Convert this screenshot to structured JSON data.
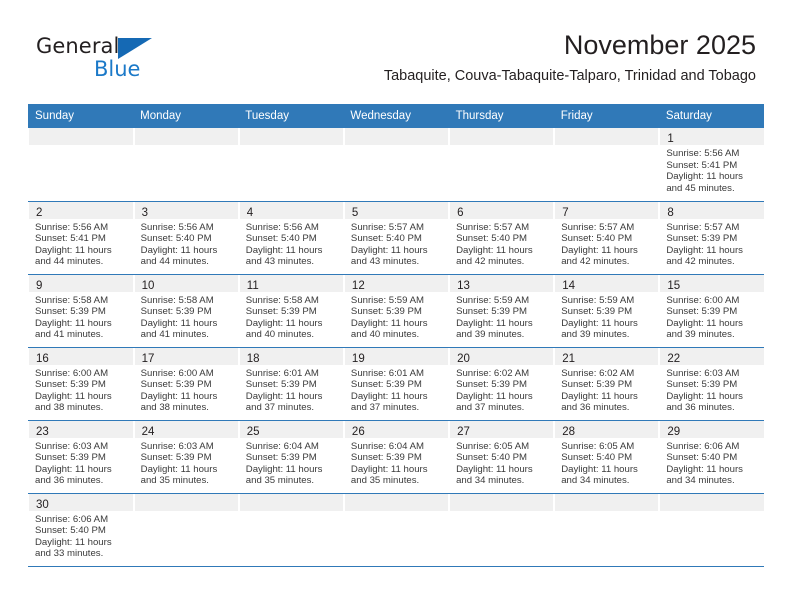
{
  "logo": {
    "word_top": "General",
    "word_bottom": "Blue",
    "flag_icon": "blue-triangle-flag-icon",
    "accent_color": "#1b79c8"
  },
  "header": {
    "title": "November 2025",
    "subtitle": "Tabaquite, Couva-Tabaquite-Talparo, Trinidad and Tobago"
  },
  "theme": {
    "header_blue": "#3079b8",
    "daynum_band": "#f0f0f0",
    "text": "#231f20"
  },
  "weekdays": [
    "Sunday",
    "Monday",
    "Tuesday",
    "Wednesday",
    "Thursday",
    "Friday",
    "Saturday"
  ],
  "weeks": [
    [
      {
        "day": "",
        "sunrise": "",
        "sunset": "",
        "daylight_line1": "",
        "daylight_line2": "",
        "empty": true
      },
      {
        "day": "",
        "sunrise": "",
        "sunset": "",
        "daylight_line1": "",
        "daylight_line2": "",
        "empty": true
      },
      {
        "day": "",
        "sunrise": "",
        "sunset": "",
        "daylight_line1": "",
        "daylight_line2": "",
        "empty": true
      },
      {
        "day": "",
        "sunrise": "",
        "sunset": "",
        "daylight_line1": "",
        "daylight_line2": "",
        "empty": true
      },
      {
        "day": "",
        "sunrise": "",
        "sunset": "",
        "daylight_line1": "",
        "daylight_line2": "",
        "empty": true
      },
      {
        "day": "",
        "sunrise": "",
        "sunset": "",
        "daylight_line1": "",
        "daylight_line2": "",
        "empty": true
      },
      {
        "day": "1",
        "sunrise": "Sunrise: 5:56 AM",
        "sunset": "Sunset: 5:41 PM",
        "daylight_line1": "Daylight: 11 hours",
        "daylight_line2": "and 45 minutes.",
        "empty": false
      }
    ],
    [
      {
        "day": "2",
        "sunrise": "Sunrise: 5:56 AM",
        "sunset": "Sunset: 5:41 PM",
        "daylight_line1": "Daylight: 11 hours",
        "daylight_line2": "and 44 minutes.",
        "empty": false
      },
      {
        "day": "3",
        "sunrise": "Sunrise: 5:56 AM",
        "sunset": "Sunset: 5:40 PM",
        "daylight_line1": "Daylight: 11 hours",
        "daylight_line2": "and 44 minutes.",
        "empty": false
      },
      {
        "day": "4",
        "sunrise": "Sunrise: 5:56 AM",
        "sunset": "Sunset: 5:40 PM",
        "daylight_line1": "Daylight: 11 hours",
        "daylight_line2": "and 43 minutes.",
        "empty": false
      },
      {
        "day": "5",
        "sunrise": "Sunrise: 5:57 AM",
        "sunset": "Sunset: 5:40 PM",
        "daylight_line1": "Daylight: 11 hours",
        "daylight_line2": "and 43 minutes.",
        "empty": false
      },
      {
        "day": "6",
        "sunrise": "Sunrise: 5:57 AM",
        "sunset": "Sunset: 5:40 PM",
        "daylight_line1": "Daylight: 11 hours",
        "daylight_line2": "and 42 minutes.",
        "empty": false
      },
      {
        "day": "7",
        "sunrise": "Sunrise: 5:57 AM",
        "sunset": "Sunset: 5:40 PM",
        "daylight_line1": "Daylight: 11 hours",
        "daylight_line2": "and 42 minutes.",
        "empty": false
      },
      {
        "day": "8",
        "sunrise": "Sunrise: 5:57 AM",
        "sunset": "Sunset: 5:39 PM",
        "daylight_line1": "Daylight: 11 hours",
        "daylight_line2": "and 42 minutes.",
        "empty": false
      }
    ],
    [
      {
        "day": "9",
        "sunrise": "Sunrise: 5:58 AM",
        "sunset": "Sunset: 5:39 PM",
        "daylight_line1": "Daylight: 11 hours",
        "daylight_line2": "and 41 minutes.",
        "empty": false
      },
      {
        "day": "10",
        "sunrise": "Sunrise: 5:58 AM",
        "sunset": "Sunset: 5:39 PM",
        "daylight_line1": "Daylight: 11 hours",
        "daylight_line2": "and 41 minutes.",
        "empty": false
      },
      {
        "day": "11",
        "sunrise": "Sunrise: 5:58 AM",
        "sunset": "Sunset: 5:39 PM",
        "daylight_line1": "Daylight: 11 hours",
        "daylight_line2": "and 40 minutes.",
        "empty": false
      },
      {
        "day": "12",
        "sunrise": "Sunrise: 5:59 AM",
        "sunset": "Sunset: 5:39 PM",
        "daylight_line1": "Daylight: 11 hours",
        "daylight_line2": "and 40 minutes.",
        "empty": false
      },
      {
        "day": "13",
        "sunrise": "Sunrise: 5:59 AM",
        "sunset": "Sunset: 5:39 PM",
        "daylight_line1": "Daylight: 11 hours",
        "daylight_line2": "and 39 minutes.",
        "empty": false
      },
      {
        "day": "14",
        "sunrise": "Sunrise: 5:59 AM",
        "sunset": "Sunset: 5:39 PM",
        "daylight_line1": "Daylight: 11 hours",
        "daylight_line2": "and 39 minutes.",
        "empty": false
      },
      {
        "day": "15",
        "sunrise": "Sunrise: 6:00 AM",
        "sunset": "Sunset: 5:39 PM",
        "daylight_line1": "Daylight: 11 hours",
        "daylight_line2": "and 39 minutes.",
        "empty": false
      }
    ],
    [
      {
        "day": "16",
        "sunrise": "Sunrise: 6:00 AM",
        "sunset": "Sunset: 5:39 PM",
        "daylight_line1": "Daylight: 11 hours",
        "daylight_line2": "and 38 minutes.",
        "empty": false
      },
      {
        "day": "17",
        "sunrise": "Sunrise: 6:00 AM",
        "sunset": "Sunset: 5:39 PM",
        "daylight_line1": "Daylight: 11 hours",
        "daylight_line2": "and 38 minutes.",
        "empty": false
      },
      {
        "day": "18",
        "sunrise": "Sunrise: 6:01 AM",
        "sunset": "Sunset: 5:39 PM",
        "daylight_line1": "Daylight: 11 hours",
        "daylight_line2": "and 37 minutes.",
        "empty": false
      },
      {
        "day": "19",
        "sunrise": "Sunrise: 6:01 AM",
        "sunset": "Sunset: 5:39 PM",
        "daylight_line1": "Daylight: 11 hours",
        "daylight_line2": "and 37 minutes.",
        "empty": false
      },
      {
        "day": "20",
        "sunrise": "Sunrise: 6:02 AM",
        "sunset": "Sunset: 5:39 PM",
        "daylight_line1": "Daylight: 11 hours",
        "daylight_line2": "and 37 minutes.",
        "empty": false
      },
      {
        "day": "21",
        "sunrise": "Sunrise: 6:02 AM",
        "sunset": "Sunset: 5:39 PM",
        "daylight_line1": "Daylight: 11 hours",
        "daylight_line2": "and 36 minutes.",
        "empty": false
      },
      {
        "day": "22",
        "sunrise": "Sunrise: 6:03 AM",
        "sunset": "Sunset: 5:39 PM",
        "daylight_line1": "Daylight: 11 hours",
        "daylight_line2": "and 36 minutes.",
        "empty": false
      }
    ],
    [
      {
        "day": "23",
        "sunrise": "Sunrise: 6:03 AM",
        "sunset": "Sunset: 5:39 PM",
        "daylight_line1": "Daylight: 11 hours",
        "daylight_line2": "and 36 minutes.",
        "empty": false
      },
      {
        "day": "24",
        "sunrise": "Sunrise: 6:03 AM",
        "sunset": "Sunset: 5:39 PM",
        "daylight_line1": "Daylight: 11 hours",
        "daylight_line2": "and 35 minutes.",
        "empty": false
      },
      {
        "day": "25",
        "sunrise": "Sunrise: 6:04 AM",
        "sunset": "Sunset: 5:39 PM",
        "daylight_line1": "Daylight: 11 hours",
        "daylight_line2": "and 35 minutes.",
        "empty": false
      },
      {
        "day": "26",
        "sunrise": "Sunrise: 6:04 AM",
        "sunset": "Sunset: 5:39 PM",
        "daylight_line1": "Daylight: 11 hours",
        "daylight_line2": "and 35 minutes.",
        "empty": false
      },
      {
        "day": "27",
        "sunrise": "Sunrise: 6:05 AM",
        "sunset": "Sunset: 5:40 PM",
        "daylight_line1": "Daylight: 11 hours",
        "daylight_line2": "and 34 minutes.",
        "empty": false
      },
      {
        "day": "28",
        "sunrise": "Sunrise: 6:05 AM",
        "sunset": "Sunset: 5:40 PM",
        "daylight_line1": "Daylight: 11 hours",
        "daylight_line2": "and 34 minutes.",
        "empty": false
      },
      {
        "day": "29",
        "sunrise": "Sunrise: 6:06 AM",
        "sunset": "Sunset: 5:40 PM",
        "daylight_line1": "Daylight: 11 hours",
        "daylight_line2": "and 34 minutes.",
        "empty": false
      }
    ],
    [
      {
        "day": "30",
        "sunrise": "Sunrise: 6:06 AM",
        "sunset": "Sunset: 5:40 PM",
        "daylight_line1": "Daylight: 11 hours",
        "daylight_line2": "and 33 minutes.",
        "empty": false
      },
      {
        "day": "",
        "sunrise": "",
        "sunset": "",
        "daylight_line1": "",
        "daylight_line2": "",
        "empty": true
      },
      {
        "day": "",
        "sunrise": "",
        "sunset": "",
        "daylight_line1": "",
        "daylight_line2": "",
        "empty": true
      },
      {
        "day": "",
        "sunrise": "",
        "sunset": "",
        "daylight_line1": "",
        "daylight_line2": "",
        "empty": true
      },
      {
        "day": "",
        "sunrise": "",
        "sunset": "",
        "daylight_line1": "",
        "daylight_line2": "",
        "empty": true
      },
      {
        "day": "",
        "sunrise": "",
        "sunset": "",
        "daylight_line1": "",
        "daylight_line2": "",
        "empty": true
      },
      {
        "day": "",
        "sunrise": "",
        "sunset": "",
        "daylight_line1": "",
        "daylight_line2": "",
        "empty": true
      }
    ]
  ]
}
